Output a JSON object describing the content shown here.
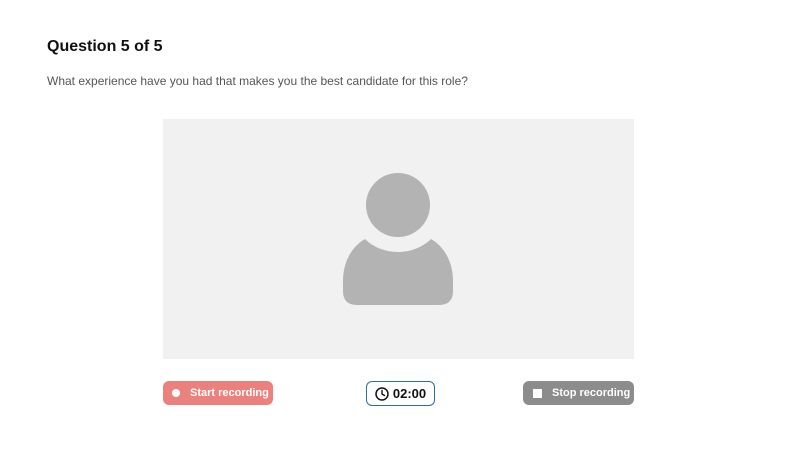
{
  "question": {
    "title": "Question 5 of 5",
    "text": "What experience  have you had that makes you the best candidate for this role?"
  },
  "video": {
    "placeholder_icon": "user-silhouette-icon"
  },
  "controls": {
    "start_label": "Start recording",
    "stop_label": "Stop recording",
    "timer_value": "02:00",
    "start_color": "#eb817d",
    "stop_color": "#8c8c8c",
    "timer_border_color": "#2f6f9a"
  }
}
